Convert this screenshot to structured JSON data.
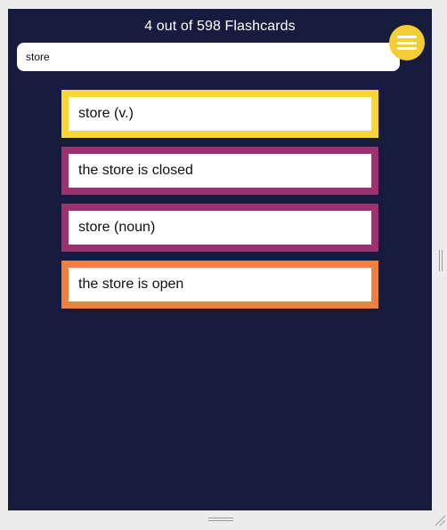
{
  "header": {
    "title": "4 out of 598 Flashcards"
  },
  "search": {
    "value": "store",
    "placeholder": ""
  },
  "menu": {
    "icon": "hamburger-menu-icon",
    "color": "#f2cd33"
  },
  "colors": {
    "background": "#171b3d",
    "yellow": "#f9d53a",
    "purple": "#9c3270",
    "orange": "#ee8140"
  },
  "cards": [
    {
      "text": "store (v.)",
      "color": "#f9d53a"
    },
    {
      "text": "the store is closed",
      "color": "#9c3270"
    },
    {
      "text": "store (noun)",
      "color": "#9c3270"
    },
    {
      "text": "the store is open",
      "color": "#ee8140"
    }
  ]
}
